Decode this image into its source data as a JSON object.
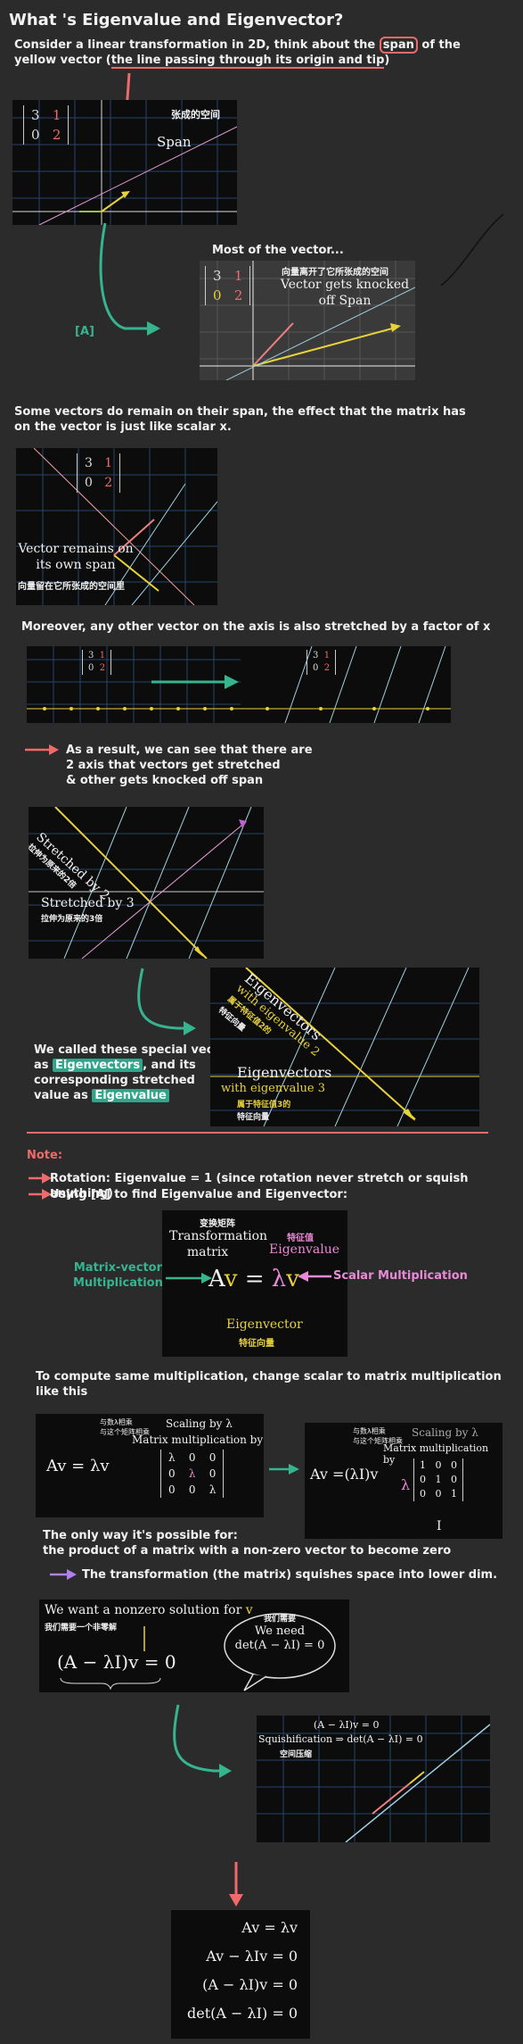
{
  "title": "What 's Eigenvalue and Eigenvector?",
  "intro": {
    "line1a": "Consider a linear transformation in 2D, think about the ",
    "span_word": "span",
    "line1b": " of the",
    "line2a": "yellow vector (",
    "line2_ul": "the line passing through its origin and tip",
    "line2b": ")"
  },
  "matrix": {
    "a": "3",
    "b": "1",
    "c": "0",
    "d": "2"
  },
  "fig1": {
    "cn": "张成的空间",
    "label": "Span"
  },
  "fig2": {
    "heading": "Most of the vector...",
    "cn": "向量离开了它所张成的空间",
    "label1": "Vector gets knocked",
    "label2": "off Span",
    "tag": "[A]"
  },
  "para2": {
    "l1": "Some vectors do remain on their span, the effect that the matrix has",
    "l2": "on the vector is just like scalar x."
  },
  "fig3": {
    "l1": "Vector remains on",
    "l2": "its own span",
    "cn": "向量留在它所张成的空间里"
  },
  "para3": "Moreover, any other vector on the axis is also stretched by a factor of x",
  "para4": {
    "l1": "As a result, we can see that there are",
    "l2": "2 axis that vectors get stretched",
    "l3": "& other gets knocked off span"
  },
  "fig5": {
    "s2": "Stretched by 2",
    "cn2": "拉伸为原来的2倍",
    "s3": "Stretched by 3",
    "cn3": "拉伸为原来的3倍"
  },
  "para5": {
    "l1": "We called these special vecto",
    "l2a": "as ",
    "l2hl": "Eigenvectors",
    "l2b": ", and its",
    "l3": "corresponding stretched",
    "l4a": "value as ",
    "l4hl": "Eigenvalue"
  },
  "fig6": {
    "ev1": "Eigenvectors",
    "ev1b": "with eigenvalue 2",
    "cn1": "属于特征值2的",
    "cn1b": "特征向量",
    "ev2": "Eigenvectors",
    "ev2b": "with eigenvalue 3",
    "cn2": "属于特征值3的",
    "cn2b": "特征向量"
  },
  "note": {
    "heading": "Note:",
    "r1": "Rotation: Eigenvalue = 1 (since rotation never stretch or squish anything)",
    "r2": "Using [A] to find Eigenvalue and Eigenvector:"
  },
  "fig7": {
    "cn_tm": "变换矩阵",
    "tm1": "Transformation",
    "tm2": "matrix",
    "cn_ev": "特征值",
    "ev": "Eigenvalue",
    "eq_l": "A",
    "eq_m": "v",
    "eq_eq": "=",
    "eq_r": "λ",
    "ev_vec": "Eigenvector",
    "cn_vec": "特征向量",
    "left1": "Matrix-vector",
    "left2": "Multiplication",
    "right": "Scalar Multiplication"
  },
  "para7": "To compute same multiplication, change scalar to matrix multiplication like this",
  "fig8": {
    "eq": "Av = λv",
    "cn1": "与数λ相乘",
    "cn2": "与这个矩阵相乘",
    "scal": "Scaling by λ",
    "mm": "Matrix multiplication by",
    "m": [
      "λ",
      "0",
      "0",
      "0",
      "λ",
      "0",
      "0",
      "0",
      "λ"
    ]
  },
  "fig9": {
    "eq": "Av =(λI)v",
    "cn1": "与数λ相乘",
    "cn2": "与这个矩阵相乘",
    "scal": "Scaling by λ",
    "mm": "Matrix multiplication by",
    "m": [
      "1",
      "0",
      "0",
      "0",
      "1",
      "0",
      "0",
      "0",
      "1"
    ],
    "lam": "λ",
    "I": "I"
  },
  "para8": {
    "l1": "The only way it's possible for:",
    "l2": "the product of a matrix with a non-zero vector to become zero",
    "l3": "The transformation (the matrix) squishes space into lower dim."
  },
  "fig10": {
    "want": "We want a nonzero solution for",
    "cn": "我们需要一个非零解",
    "cn_need": "我们需要",
    "need1": "We need",
    "need2": "det(A − λI) = 0",
    "eq": "(A − λI)v = 0"
  },
  "fig11": {
    "top": "(A − λI)v = 0",
    "sq": "Squishification ⇒ det(A − λI) = 0",
    "cn": "空间压缩"
  },
  "fig12": {
    "e1": "Av = λv",
    "e2": "Av − λIv = 0",
    "e3": "(A − λI)v = 0",
    "e4": "det(A − λI) = 0"
  }
}
